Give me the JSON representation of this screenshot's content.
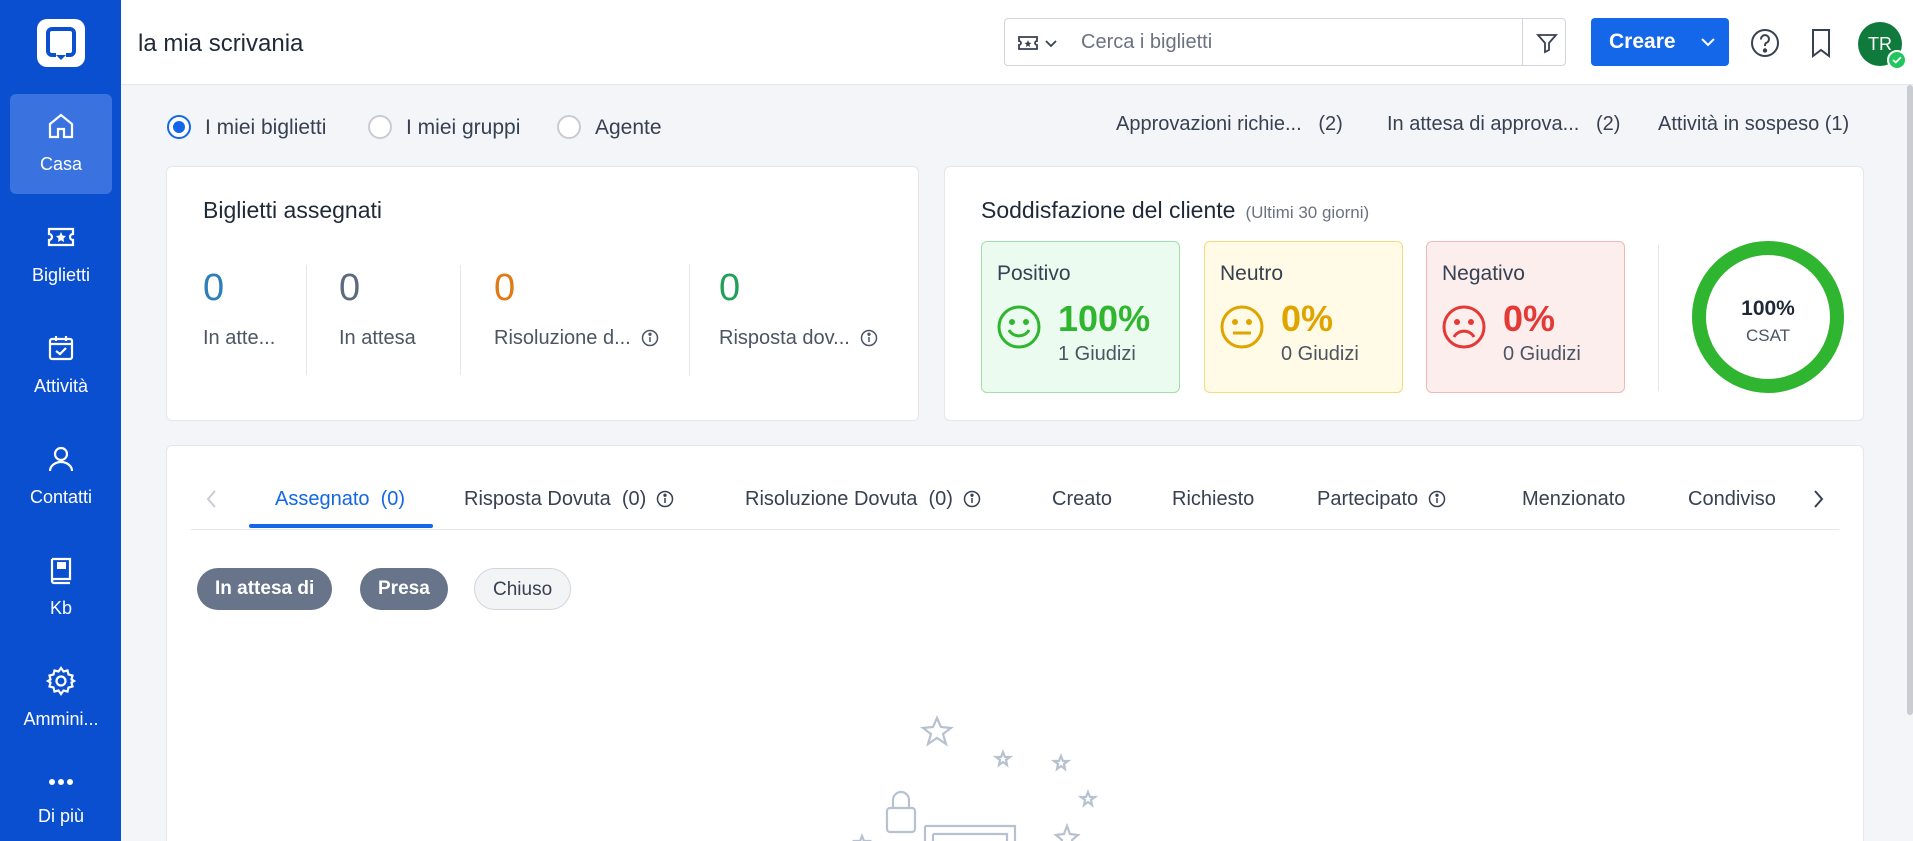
{
  "sidebar": {
    "items": [
      {
        "label": "Casa",
        "icon": "home-icon",
        "active": true
      },
      {
        "label": "Biglietti",
        "icon": "ticket-icon"
      },
      {
        "label": "Attività",
        "icon": "calendar-check-icon"
      },
      {
        "label": "Contatti",
        "icon": "user-icon"
      },
      {
        "label": "Kb",
        "icon": "book-icon"
      },
      {
        "label": "Ammini...",
        "icon": "gear-icon"
      },
      {
        "label": "Di più",
        "icon": "more-dots-icon"
      }
    ]
  },
  "header": {
    "title": "la mia scrivania",
    "search_placeholder": "Cerca i biglietti",
    "create_label": "Creare",
    "avatar_initials": "TR"
  },
  "scope": {
    "options": [
      "I miei biglietti",
      "I miei gruppi",
      "Agente"
    ],
    "selected": "I miei biglietti"
  },
  "quick_links": [
    {
      "label": "Approvazioni richie...",
      "count": "(2)"
    },
    {
      "label": "In attesa di approva...",
      "count": "(2)"
    },
    {
      "label": "Attività in sospeso",
      "count": "(1)"
    }
  ],
  "assigned_card": {
    "title": "Biglietti assegnati",
    "stats": [
      {
        "value": "0",
        "label": "In atte...",
        "color": "#2e7fb8"
      },
      {
        "value": "0",
        "label": "In attesa",
        "color": "#5b6b7d"
      },
      {
        "value": "0",
        "label": "Risoluzione d...",
        "color": "#e07a14"
      },
      {
        "value": "0",
        "label": "Risposta dov...",
        "color": "#22a05a"
      }
    ]
  },
  "csat_card": {
    "title": "Soddisfazione del cliente",
    "subtitle": "(Ultimi 30 giorni)",
    "sentiments": [
      {
        "label": "Positivo",
        "percent": "100%",
        "count": "1 Giudizi",
        "color": "#2fb52f"
      },
      {
        "label": "Neutro",
        "percent": "0%",
        "count": "0 Giudizi",
        "color": "#e0a400"
      },
      {
        "label": "Negativo",
        "percent": "0%",
        "count": "0 Giudizi",
        "color": "#e53935"
      }
    ],
    "csat_value": "100%",
    "csat_label": "CSAT",
    "csat_fraction": 1.0
  },
  "tabs": [
    {
      "label": "Assegnato",
      "count": "(0)",
      "active": true
    },
    {
      "label": "Risposta Dovuta",
      "count": "(0)",
      "info": true
    },
    {
      "label": "Risoluzione Dovuta",
      "count": "(0)",
      "info": true
    },
    {
      "label": "Creato",
      "count": ""
    },
    {
      "label": "Richiesto",
      "count": ""
    },
    {
      "label": "Partecipato",
      "count": "",
      "info": true
    },
    {
      "label": "Menzionato",
      "count": ""
    },
    {
      "label": "Condiviso",
      "count": ""
    }
  ],
  "status_filters": [
    "In attesa di",
    "Presa",
    "Chiuso"
  ],
  "colors": {
    "sidebar": "#0b4fd1",
    "accent": "#1367e8"
  }
}
